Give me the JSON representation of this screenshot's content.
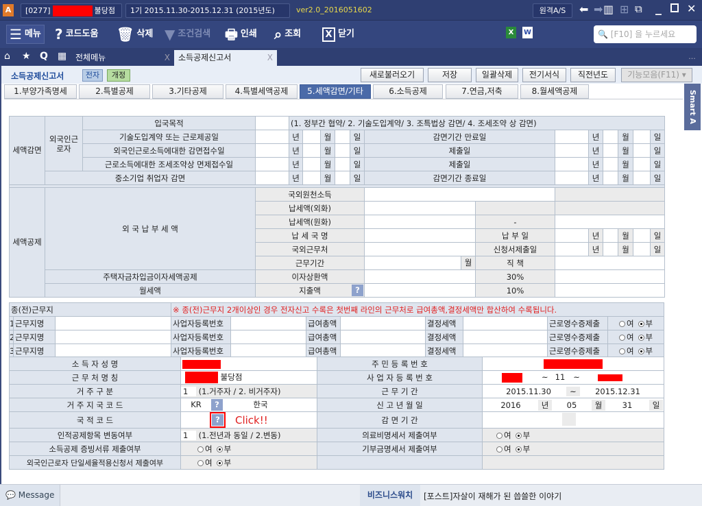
{
  "titlebar": {
    "company": "[0277]",
    "branch": "불당점",
    "period": "1기 2015.11.30-2015.12.31",
    "fiscal_year": "(2015년도)",
    "version": "ver2.0_2016051602",
    "remote_as": "원격A/S"
  },
  "toolbar": {
    "menu": "메뉴",
    "code_help": "코드도움",
    "delete": "삭제",
    "filter": "조건검색",
    "print": "인쇄",
    "search": "조회",
    "close": "닫기",
    "search_placeholder": "[F10] 을 누르세요"
  },
  "tabs": {
    "all_menu": "전체메뉴",
    "current": "소득공제신고서",
    "close": "X",
    "more": "..."
  },
  "header": {
    "title": "소득공제신고서",
    "badge_e": "전자",
    "badge_rev": "개정",
    "buttons": [
      "새로불러오기",
      "저장",
      "일괄삭제",
      "전기서식",
      "직전년도",
      "기능모음(F11)"
    ]
  },
  "subtabs": [
    "1.부양가족명세",
    "2.특별공제",
    "3.기타공제",
    "4.특별세액공제",
    "5.세액감면/기타",
    "6.소득공제",
    "7.연금,저축",
    "8.월세액공제"
  ],
  "smart": "Smart A",
  "units": {
    "year": "년",
    "month": "월",
    "day": "일",
    "tilde": "~"
  },
  "reduction": {
    "section": "세액감면",
    "foreign_worker": "외국인근로자",
    "entry_purpose": "입국목적",
    "entry_purpose_hint": "(1. 정부간 협약/ 2. 기술도입계약/ 3. 조특법상 감면/ 4. 조세조약 상 감면)",
    "rows": [
      {
        "label": "기술도입계약 또는 근로제공일",
        "right": "감면기간 만료일"
      },
      {
        "label": "외국인근로소득에대한 감면접수일",
        "right": "제출일"
      },
      {
        "label": "근로소득에대한 조세조약상 면제접수일",
        "right": "제출일"
      }
    ],
    "sme": "중소기업 취업자 감면",
    "sme_right": "감면기간 종료일"
  },
  "credit": {
    "section": "세액공제",
    "foreign_tax": "외 국 납 부 세 액",
    "income": "국외원천소득",
    "tax_fx": "납세액(외화)",
    "tax_krw": "납세액(원화)",
    "tax_krw_dash": "-",
    "country": "납 세 국 명",
    "pay_date": "납 부 일",
    "workplace": "국외근무처",
    "apply_date": "신청서제출일",
    "period": "근무기간",
    "month": "월",
    "position": "직   책",
    "housing": "주택자금차입금이자세액공제",
    "interest": "이자상환액",
    "rate30": "30%",
    "rent": "월세액",
    "spend": "지출액",
    "rate10": "10%"
  },
  "prev": {
    "title": "종(전)근무지",
    "notice": "※ 종(전)근무지 2개이상인 경우 전자신고 수록은 첫번째 라인의 근무처로 급여총액,결정세액만 합산하여 수록됩니다.",
    "rows": [
      {
        "no": "1"
      },
      {
        "no": "2"
      },
      {
        "no": "3"
      }
    ],
    "name": "근무지명",
    "bizno": "사업자등록번호",
    "salary": "급여총액",
    "tax": "결정세액",
    "receipt": "근로영수증제출",
    "yes": "여",
    "no": "부"
  },
  "info": {
    "name_label": "소 득 자 성 명",
    "rrn_label": "주 민 등 록 번 호",
    "work_label": "근 무 처 명 칭",
    "work_suffix": "불당점",
    "bizno_label": "사 업 자 등 록 번 호",
    "bizno_mid": "11",
    "resident_label": "거 주 구 분",
    "resident_val": "1",
    "resident_hint": "(1.거주자 / 2. 비거주자)",
    "period_label": "근 무 기 간",
    "period_from": "2015.11.30",
    "period_to": "2015.12.31",
    "country_label": "거 주 지 국 코 드",
    "country_code": "KR",
    "country_name": "한국",
    "report_label": "신 고 년 월 일",
    "report_year": "2016",
    "report_month": "05",
    "report_day": "31",
    "nation_label": "국 적 코 드",
    "click": "Click!!",
    "reduce_label": "감 면 기 간",
    "change_label": "인적공제항목 변동여부",
    "change_val": "1",
    "change_hint": "(1.전년과 동일 / 2.변동)",
    "medical_label": "의료비명세서 제출여부",
    "proof_label": "소득공제 증빙서류 제출여부",
    "donation_label": "기부금명세서 제출여부",
    "flat_label": "외국인근로자 단일세율적용신청서 제출여부",
    "yes": "여",
    "no": "부"
  },
  "status": {
    "message": "Message",
    "bizwatch": "비즈니스워치",
    "news": "[포스트]자살이 재해가 된 씁쓸한 이야기"
  }
}
